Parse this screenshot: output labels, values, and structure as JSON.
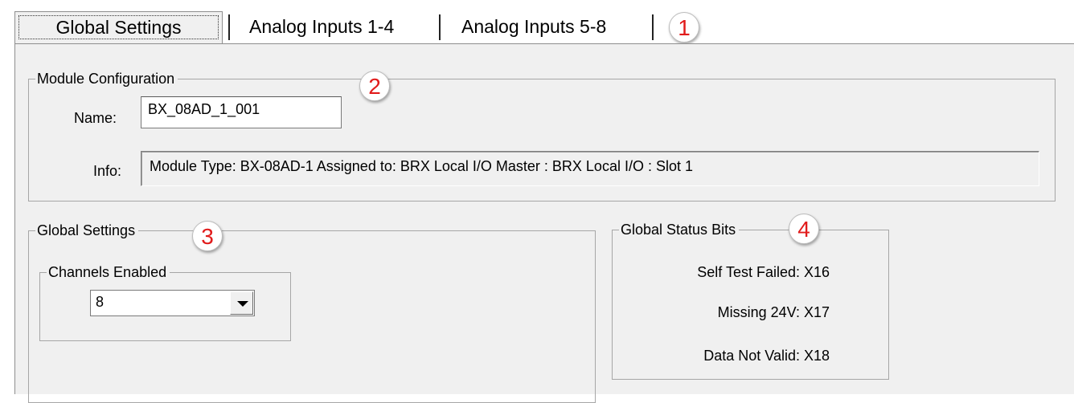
{
  "tabs": [
    {
      "label": "Global Settings"
    },
    {
      "label": "Analog Inputs 1-4"
    },
    {
      "label": "Analog Inputs 5-8"
    }
  ],
  "callouts": [
    "1",
    "2",
    "3",
    "4"
  ],
  "module_config": {
    "title": "Module Configuration",
    "name_label": "Name:",
    "name_value": "BX_08AD_1_001",
    "info_label": "Info:",
    "info_value": "Module Type: BX-08AD-1   Assigned to: BRX Local I/O Master : BRX Local I/O : Slot 1"
  },
  "global_settings": {
    "title": "Global Settings",
    "channels": {
      "title": "Channels Enabled",
      "selected": "8"
    }
  },
  "status_bits": {
    "title": "Global Status Bits",
    "items": [
      {
        "label": "Self Test Failed:",
        "value": "X16"
      },
      {
        "label": "Missing 24V:",
        "value": "X17"
      },
      {
        "label": "Data Not Valid:",
        "value": "X18"
      }
    ]
  },
  "icons": {
    "dropdown": "chevron-down-icon"
  },
  "colors": {
    "callout_text": "#e11b1b",
    "panel_bg": "#f0f0f0"
  }
}
